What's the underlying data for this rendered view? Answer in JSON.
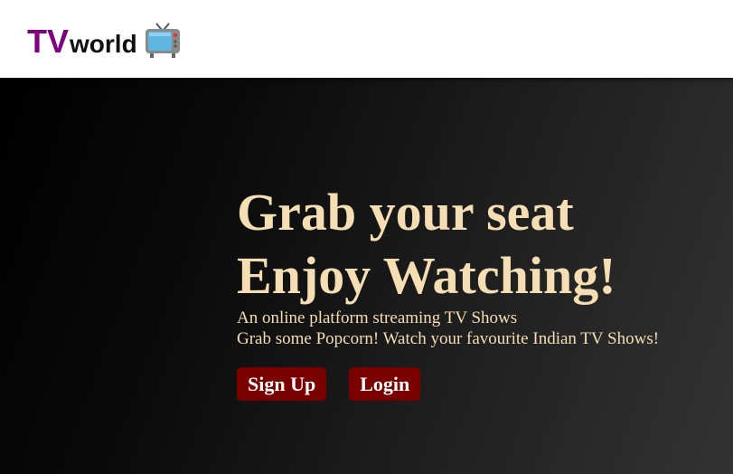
{
  "navbar": {
    "logo_tv": "TV",
    "logo_world": "world",
    "logo_icon": "television-icon"
  },
  "hero": {
    "headline_line1": "Grab your seat",
    "headline_line2": "Enjoy Watching!",
    "sub_line1": "An online platform streaming TV Shows",
    "sub_line2": "Grab some Popcorn! Watch your favourite Indian TV Shows!",
    "signup_label": "Sign Up",
    "login_label": "Login"
  },
  "colors": {
    "brand_purple": "#800080",
    "headline_text": "#f5deb3",
    "button_bg": "#7a0000"
  }
}
